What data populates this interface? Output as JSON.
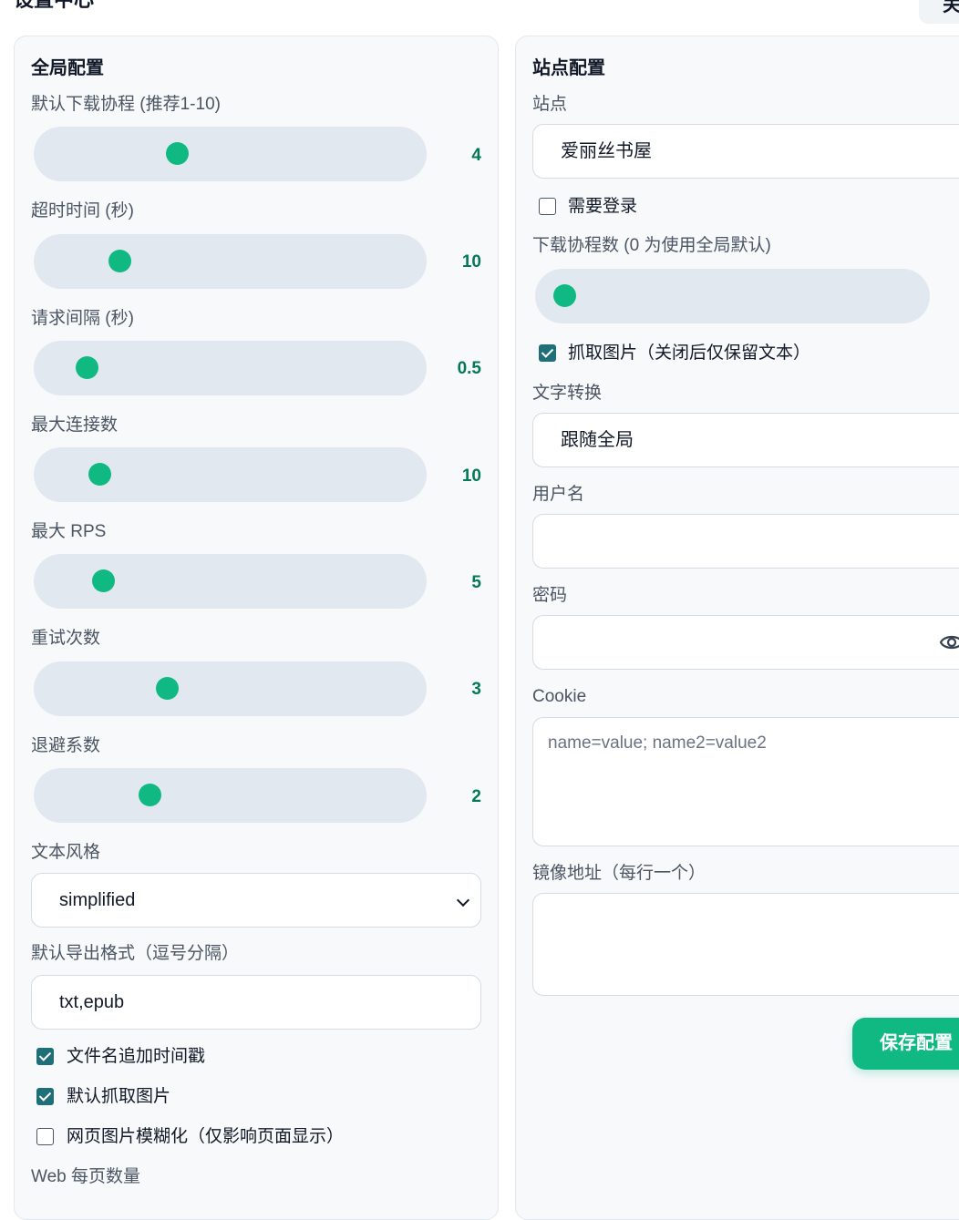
{
  "header": {
    "title": "设置中心",
    "close_label": "关闭"
  },
  "global": {
    "title": "全局配置",
    "sliders": [
      {
        "label": "默认下载协程 (推荐1-10)",
        "value": "4",
        "fraction": 0.34
      },
      {
        "label": "超时时间 (秒)",
        "value": "10",
        "fraction": 0.17
      },
      {
        "label": "请求间隔 (秒)",
        "value": "0.5",
        "fraction": 0.07
      },
      {
        "label": "最大连接数",
        "value": "10",
        "fraction": 0.11
      },
      {
        "label": "最大 RPS",
        "value": "5",
        "fraction": 0.12
      },
      {
        "label": "重试次数",
        "value": "3",
        "fraction": 0.31
      },
      {
        "label": "退避系数",
        "value": "2",
        "fraction": 0.26
      }
    ],
    "text_style": {
      "label": "文本风格",
      "value": "simplified"
    },
    "export_format": {
      "label": "默认导出格式（逗号分隔）",
      "value": "txt,epub"
    },
    "checkboxes": [
      {
        "label": "文件名追加时间戳",
        "checked": true
      },
      {
        "label": "默认抓取图片",
        "checked": true
      },
      {
        "label": "网页图片模糊化（仅影响页面显示）",
        "checked": false
      }
    ],
    "page_size_label": "Web 每页数量"
  },
  "site": {
    "title": "站点配置",
    "site_label": "站点",
    "site_value": "爱丽丝书屋",
    "login_required": {
      "label": "需要登录",
      "checked": false
    },
    "concurrency": {
      "label": "下载协程数 (0 为使用全局默认)",
      "fraction": 0.0
    },
    "fetch_images": {
      "label": "抓取图片（关闭后仅保留文本）",
      "checked": true
    },
    "conversion": {
      "label": "文字转换",
      "value": "跟随全局"
    },
    "username": {
      "label": "用户名",
      "value": ""
    },
    "password": {
      "label": "密码",
      "value": ""
    },
    "cookie": {
      "label": "Cookie",
      "placeholder": "name=value; name2=value2"
    },
    "mirrors": {
      "label": "镜像地址（每行一个）",
      "value": ""
    },
    "save_label": "保存配置"
  },
  "colors": {
    "accent": "#10b981",
    "value_text": "#047857",
    "track": "#e2e8f0",
    "checkbox": "#1f6f79"
  },
  "icons": [
    "chevron-down-icon",
    "eye-icon",
    "check-icon"
  ]
}
